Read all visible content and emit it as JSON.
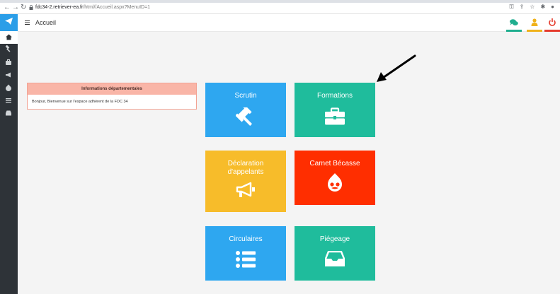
{
  "browser": {
    "url_host": "fdc34-2.retriever-ea.fr",
    "url_path": "/html//Accueil.aspx?MenuID=1"
  },
  "header": {
    "title": "Accueil",
    "colors": {
      "chat": "#1fae8f",
      "user": "#f0b21b",
      "power": "#e53b2c"
    }
  },
  "info": {
    "title": "Informations départementales",
    "message": "Bonjour, Bienvenue sur l'espace adhérent de la FDC 34"
  },
  "tiles": [
    {
      "label": "Scrutin",
      "icon": "gavel-icon",
      "color": "#2ea7f0"
    },
    {
      "label": "Formations",
      "icon": "briefcase-icon",
      "color": "#1fbc9c"
    },
    {
      "label": "Déclaration\nd'appelants",
      "icon": "megaphone-icon",
      "color": "#f7bc2a"
    },
    {
      "label": "Carnet Bécasse",
      "icon": "drupal-icon",
      "color": "#ff2e00"
    },
    {
      "label": "Circulaires",
      "icon": "list-icon",
      "color": "#2ea7f0"
    },
    {
      "label": "Piégeage",
      "icon": "inbox-icon",
      "color": "#1fbc9c"
    }
  ]
}
